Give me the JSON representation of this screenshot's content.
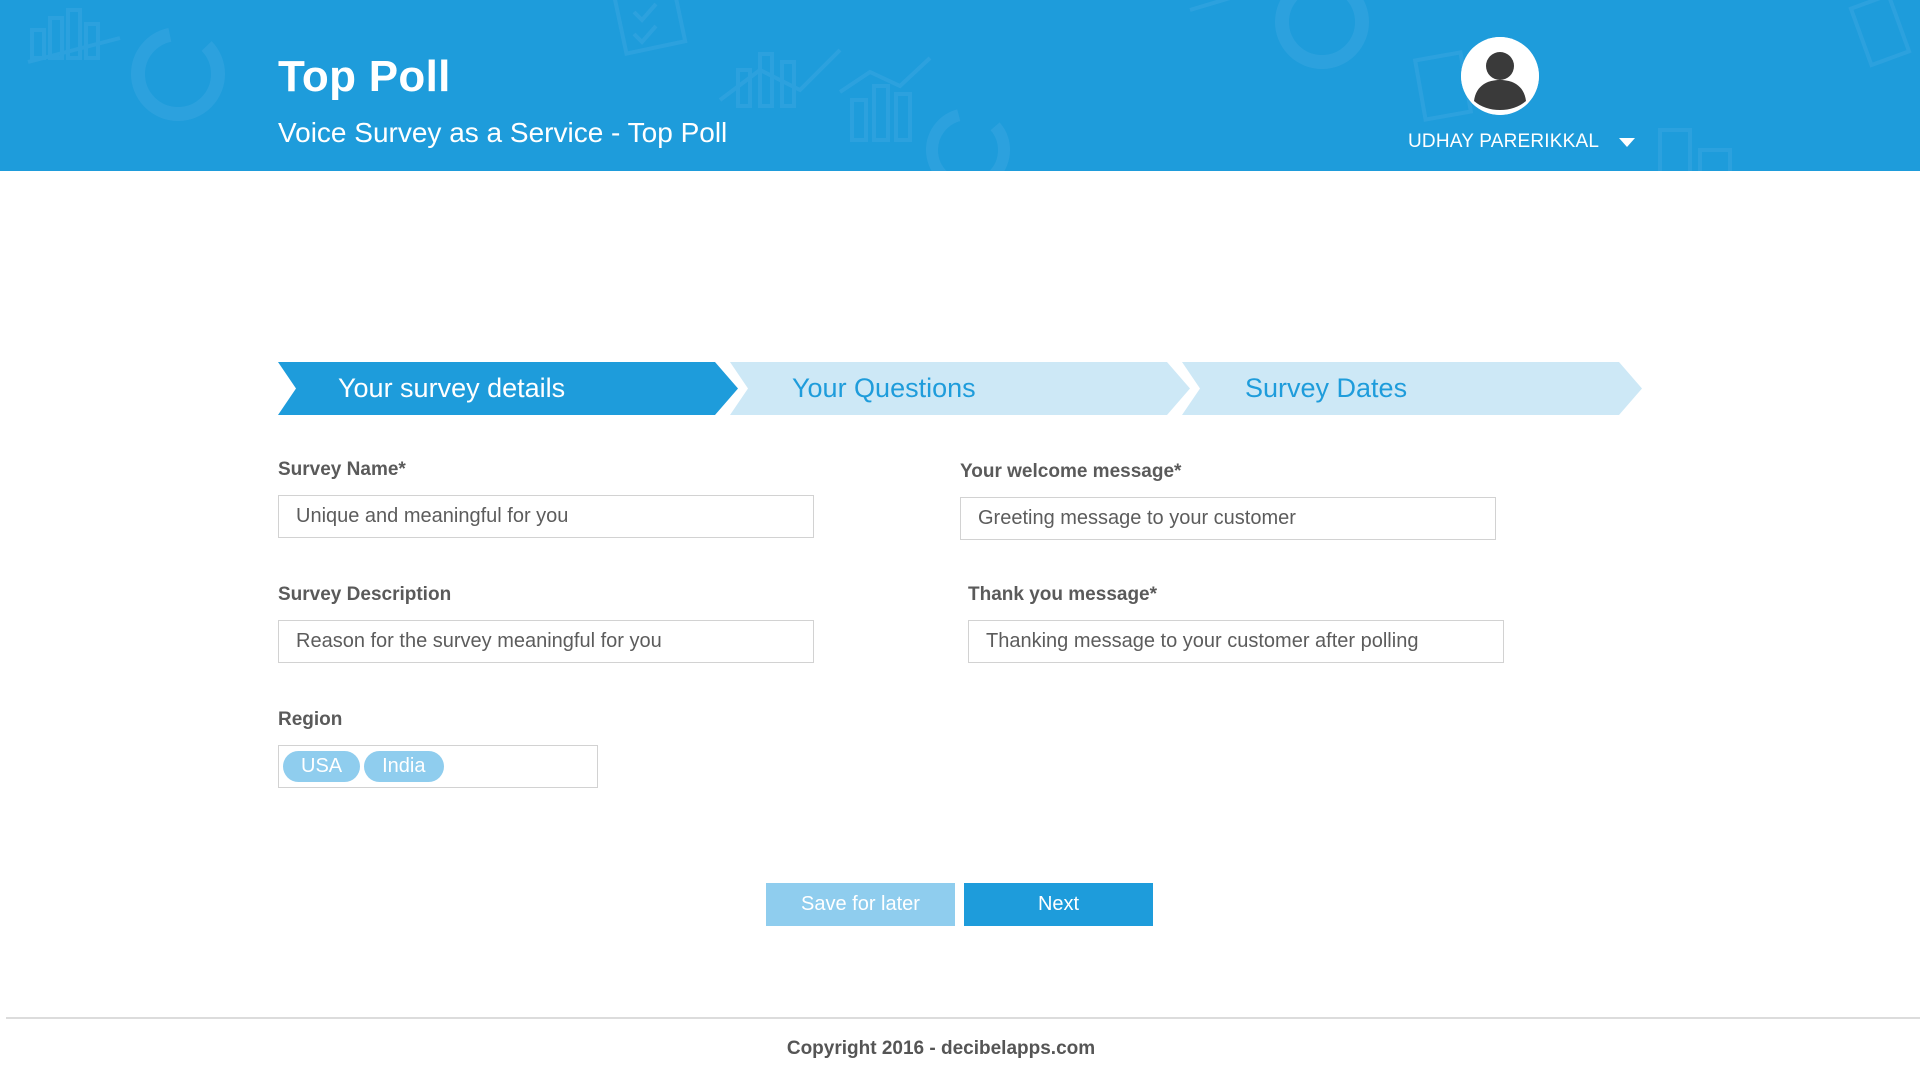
{
  "header": {
    "title": "Top Poll",
    "subtitle": "Voice Survey as a Service - Top Poll",
    "user_name": "UDHAY PARERIKKAL",
    "avatar_icon": "user-avatar-icon",
    "menu_icon": "chevron-down-icon"
  },
  "steps": [
    {
      "label": "Your survey details",
      "active": true
    },
    {
      "label": "Your Questions",
      "active": false
    },
    {
      "label": "Survey Dates",
      "active": false
    }
  ],
  "form": {
    "survey_name": {
      "label": "Survey Name*",
      "placeholder": "Unique and meaningful for you"
    },
    "survey_description": {
      "label": "Survey Description",
      "placeholder": "Reason for the survey meaningful for you"
    },
    "welcome_message": {
      "label": "Your welcome message*",
      "placeholder": "Greeting message to your customer"
    },
    "thank_you_message": {
      "label": "Thank you message*",
      "placeholder": "Thanking message to your customer after polling"
    },
    "region": {
      "label": "Region",
      "tags": [
        "USA",
        "India"
      ]
    }
  },
  "actions": {
    "save_label": "Save for later",
    "next_label": "Next"
  },
  "footer": {
    "copyright": "Copyright 2016 - decibelapps.com"
  },
  "colors": {
    "primary": "#1e9cdb",
    "primary_light": "#8fcdee",
    "step_inactive": "#cde8f6"
  }
}
